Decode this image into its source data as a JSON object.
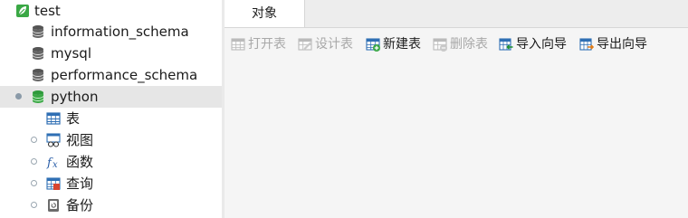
{
  "sidebar": {
    "connection": {
      "label": "test",
      "icon": "leaf-icon"
    },
    "databases": [
      {
        "label": "information_schema",
        "icon": "database-icon"
      },
      {
        "label": "mysql",
        "icon": "database-icon"
      },
      {
        "label": "performance_schema",
        "icon": "database-icon"
      },
      {
        "label": "python",
        "icon": "database-open-icon",
        "selected": true
      }
    ],
    "children": [
      {
        "label": "表",
        "icon": "table-icon"
      },
      {
        "label": "视图",
        "icon": "view-icon"
      },
      {
        "label": "函数",
        "icon": "function-icon"
      },
      {
        "label": "查询",
        "icon": "query-icon"
      },
      {
        "label": "备份",
        "icon": "backup-icon"
      }
    ]
  },
  "tabs": [
    {
      "label": "对象",
      "active": true
    }
  ],
  "toolbar": {
    "open_table": "打开表",
    "design_table": "设计表",
    "new_table": "新建表",
    "delete_table": "删除表",
    "import_wizard": "导入向导",
    "export_wizard": "导出向导"
  },
  "colors": {
    "accent_green": "#3aa845",
    "db_gray": "#555555",
    "table_blue": "#2f6fb4",
    "selected_row": "#e6e6e6",
    "disabled_text": "#a8a8a8"
  }
}
